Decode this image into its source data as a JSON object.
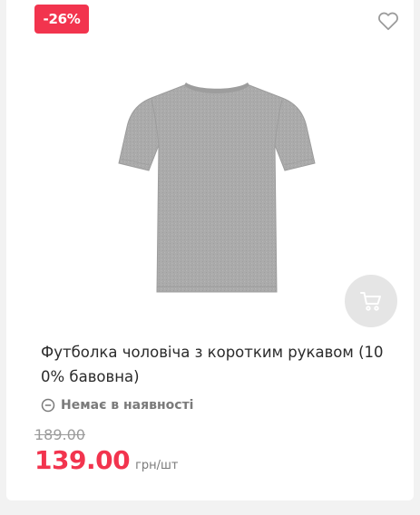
{
  "product": {
    "discount_badge": "-26%",
    "title": "Футболка чоловіча з коротким рукавом (100% бавовна)",
    "availability": "Немає в наявності",
    "old_price": "189.00",
    "price": "139.00",
    "unit": "грн/шт",
    "image_alt": "grey-tshirt"
  },
  "icons": {
    "favorite": "heart-outline-icon",
    "cart": "cart-icon",
    "availability": "minus-circle-icon"
  },
  "colors": {
    "accent": "#f2344e",
    "muted": "#7a7a7a",
    "shirt": "#a9a9a9"
  }
}
